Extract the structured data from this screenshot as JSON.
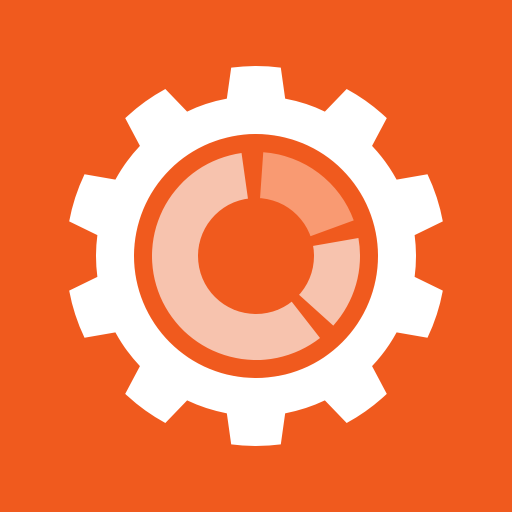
{
  "icon": {
    "name": "gear-with-donut-chart-icon",
    "colors": {
      "background": "#F05A1E",
      "gear": "#FFFFFF",
      "segment_light": "#F7C3AE",
      "segment_mid": "#F99A72",
      "center": "#F05A1E"
    }
  }
}
